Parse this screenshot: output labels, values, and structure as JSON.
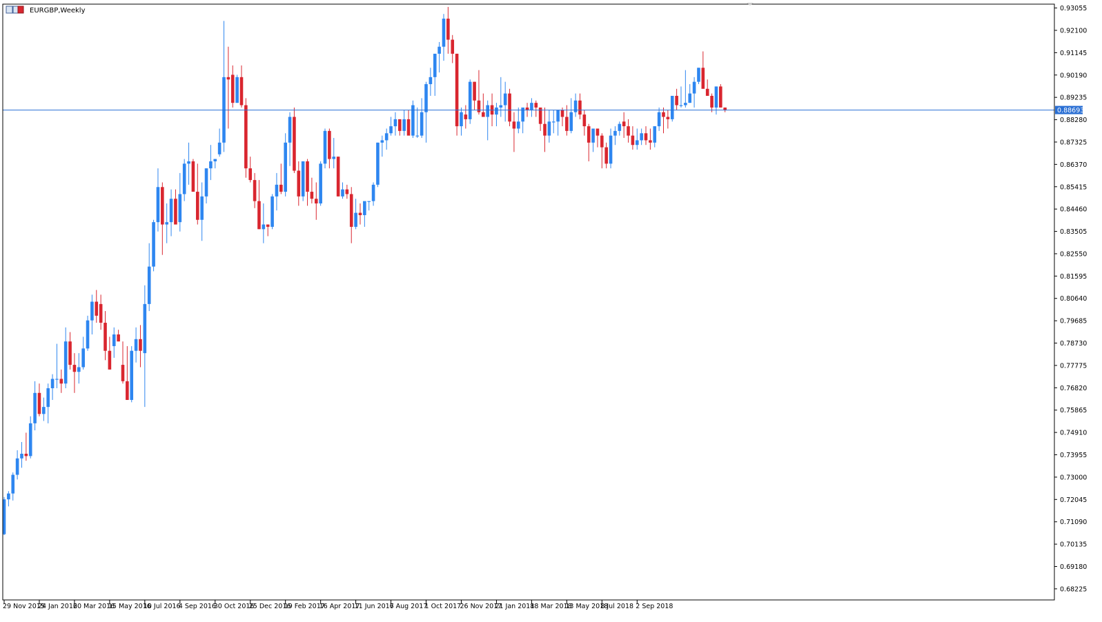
{
  "chart_title": "EURGBP,Weekly",
  "colors": {
    "bull": "#2e86f0",
    "bear": "#d9262f",
    "hline": "#2a6fd4",
    "axis": "#000000",
    "price_tag_bg": "#2a6fd4"
  },
  "icons": [
    "chart-window-icon"
  ],
  "chart_data": {
    "type": "candlestick",
    "title": "EURGBP,Weekly",
    "ylim": [
      0.6775,
      0.9322
    ],
    "y_ticks": [
      "0.93055",
      "0.92100",
      "0.91145",
      "0.90190",
      "0.89235",
      "0.88280",
      "0.87325",
      "0.86370",
      "0.85415",
      "0.84460",
      "0.83505",
      "0.82550",
      "0.81595",
      "0.80640",
      "0.79685",
      "0.78730",
      "0.77775",
      "0.76820",
      "0.75865",
      "0.74910",
      "0.73955",
      "0.73000",
      "0.72045",
      "0.71090",
      "0.70135",
      "0.69180",
      "0.68225"
    ],
    "x_ticks": [
      "29 Nov 2015",
      "24 Jan 2016",
      "20 Mar 2016",
      "15 May 2016",
      "10 Jul 2016",
      "4 Sep 2016",
      "30 Oct 2016",
      "25 Dec 2016",
      "19 Feb 2017",
      "16 Apr 2017",
      "11 Jun 2017",
      "6 Aug 2017",
      "1 Oct 2017",
      "26 Nov 2017",
      "21 Jan 2018",
      "18 Mar 2018",
      "13 May 2018",
      "8 Jul 2018",
      "2 Sep 2018"
    ],
    "horizontal_line": {
      "value": 0.88693,
      "label": "0.88693"
    },
    "ohlc": [
      [
        0.7056,
        0.7215,
        0.7052,
        0.7205
      ],
      [
        0.7205,
        0.724,
        0.7175,
        0.723
      ],
      [
        0.723,
        0.732,
        0.72,
        0.731
      ],
      [
        0.731,
        0.7415,
        0.729,
        0.738
      ],
      [
        0.738,
        0.745,
        0.734,
        0.74
      ],
      [
        0.74,
        0.749,
        0.737,
        0.739
      ],
      [
        0.739,
        0.756,
        0.738,
        0.753
      ],
      [
        0.753,
        0.771,
        0.75,
        0.766
      ],
      [
        0.766,
        0.77,
        0.756,
        0.757
      ],
      [
        0.757,
        0.764,
        0.754,
        0.76
      ],
      [
        0.76,
        0.77,
        0.753,
        0.768
      ],
      [
        0.768,
        0.774,
        0.763,
        0.772
      ],
      [
        0.772,
        0.787,
        0.768,
        0.772
      ],
      [
        0.772,
        0.776,
        0.766,
        0.77
      ],
      [
        0.77,
        0.794,
        0.768,
        0.788
      ],
      [
        0.788,
        0.792,
        0.776,
        0.778
      ],
      [
        0.778,
        0.783,
        0.766,
        0.775
      ],
      [
        0.775,
        0.783,
        0.77,
        0.777
      ],
      [
        0.777,
        0.79,
        0.776,
        0.785
      ],
      [
        0.785,
        0.799,
        0.784,
        0.797
      ],
      [
        0.797,
        0.808,
        0.791,
        0.805
      ],
      [
        0.805,
        0.81,
        0.796,
        0.799
      ],
      [
        0.804,
        0.808,
        0.793,
        0.796
      ],
      [
        0.796,
        0.801,
        0.78,
        0.784
      ],
      [
        0.784,
        0.79,
        0.776,
        0.776
      ],
      [
        0.786,
        0.794,
        0.781,
        0.791
      ],
      [
        0.791,
        0.793,
        0.788,
        0.788
      ],
      [
        0.778,
        0.788,
        0.77,
        0.771
      ],
      [
        0.771,
        0.786,
        0.763,
        0.763
      ],
      [
        0.763,
        0.786,
        0.762,
        0.784
      ],
      [
        0.784,
        0.794,
        0.779,
        0.789
      ],
      [
        0.789,
        0.795,
        0.777,
        0.784
      ],
      [
        0.783,
        0.812,
        0.76,
        0.804
      ],
      [
        0.804,
        0.83,
        0.801,
        0.82
      ],
      [
        0.82,
        0.84,
        0.818,
        0.839
      ],
      [
        0.839,
        0.862,
        0.835,
        0.854
      ],
      [
        0.854,
        0.856,
        0.825,
        0.838
      ],
      [
        0.838,
        0.847,
        0.83,
        0.839
      ],
      [
        0.839,
        0.853,
        0.833,
        0.849
      ],
      [
        0.849,
        0.853,
        0.839,
        0.838
      ],
      [
        0.839,
        0.86,
        0.835,
        0.851
      ],
      [
        0.851,
        0.866,
        0.848,
        0.864
      ],
      [
        0.864,
        0.873,
        0.855,
        0.865
      ],
      [
        0.865,
        0.866,
        0.853,
        0.852
      ],
      [
        0.852,
        0.864,
        0.838,
        0.84
      ],
      [
        0.84,
        0.856,
        0.831,
        0.85
      ],
      [
        0.85,
        0.862,
        0.847,
        0.862
      ],
      [
        0.862,
        0.872,
        0.857,
        0.865
      ],
      [
        0.865,
        0.866,
        0.862,
        0.866
      ],
      [
        0.868,
        0.879,
        0.867,
        0.873
      ],
      [
        0.873,
        0.925,
        0.869,
        0.901
      ],
      [
        0.901,
        0.914,
        0.879,
        0.9
      ],
      [
        0.902,
        0.906,
        0.888,
        0.89
      ],
      [
        0.89,
        0.902,
        0.89,
        0.901
      ],
      [
        0.901,
        0.906,
        0.888,
        0.889
      ],
      [
        0.889,
        0.892,
        0.858,
        0.862
      ],
      [
        0.862,
        0.867,
        0.856,
        0.857
      ],
      [
        0.857,
        0.86,
        0.845,
        0.848
      ],
      [
        0.848,
        0.857,
        0.836,
        0.836
      ],
      [
        0.836,
        0.847,
        0.83,
        0.838
      ],
      [
        0.838,
        0.838,
        0.833,
        0.837
      ],
      [
        0.837,
        0.851,
        0.836,
        0.85
      ],
      [
        0.85,
        0.86,
        0.844,
        0.855
      ],
      [
        0.855,
        0.864,
        0.851,
        0.852
      ],
      [
        0.852,
        0.877,
        0.85,
        0.873
      ],
      [
        0.873,
        0.886,
        0.863,
        0.884
      ],
      [
        0.884,
        0.888,
        0.86,
        0.861
      ],
      [
        0.861,
        0.865,
        0.846,
        0.85
      ],
      [
        0.85,
        0.865,
        0.848,
        0.865
      ],
      [
        0.865,
        0.866,
        0.846,
        0.852
      ],
      [
        0.852,
        0.858,
        0.847,
        0.849
      ],
      [
        0.849,
        0.856,
        0.84,
        0.847
      ],
      [
        0.847,
        0.865,
        0.846,
        0.864
      ],
      [
        0.864,
        0.879,
        0.862,
        0.878
      ],
      [
        0.878,
        0.879,
        0.862,
        0.866
      ],
      [
        0.866,
        0.875,
        0.862,
        0.867
      ],
      [
        0.867,
        0.867,
        0.85,
        0.85
      ],
      [
        0.85,
        0.856,
        0.849,
        0.853
      ],
      [
        0.853,
        0.855,
        0.849,
        0.851
      ],
      [
        0.851,
        0.854,
        0.83,
        0.837
      ],
      [
        0.837,
        0.849,
        0.836,
        0.843
      ],
      [
        0.843,
        0.847,
        0.838,
        0.842
      ],
      [
        0.842,
        0.846,
        0.837,
        0.848
      ],
      [
        0.848,
        0.848,
        0.844,
        0.848
      ],
      [
        0.848,
        0.856,
        0.846,
        0.855
      ],
      [
        0.855,
        0.873,
        0.854,
        0.873
      ],
      [
        0.873,
        0.876,
        0.867,
        0.874
      ],
      [
        0.874,
        0.879,
        0.87,
        0.877
      ],
      [
        0.877,
        0.884,
        0.876,
        0.88
      ],
      [
        0.88,
        0.886,
        0.876,
        0.883
      ],
      [
        0.883,
        0.883,
        0.876,
        0.878
      ],
      [
        0.878,
        0.887,
        0.876,
        0.883
      ],
      [
        0.883,
        0.887,
        0.877,
        0.876
      ],
      [
        0.876,
        0.891,
        0.875,
        0.889
      ],
      [
        0.876,
        0.888,
        0.875,
        0.876
      ],
      [
        0.876,
        0.892,
        0.875,
        0.886
      ],
      [
        0.886,
        0.899,
        0.873,
        0.898
      ],
      [
        0.898,
        0.905,
        0.893,
        0.901
      ],
      [
        0.901,
        0.91,
        0.893,
        0.911
      ],
      [
        0.911,
        0.916,
        0.903,
        0.914
      ],
      [
        0.914,
        0.928,
        0.908,
        0.926
      ],
      [
        0.926,
        0.931,
        0.911,
        0.917
      ],
      [
        0.917,
        0.919,
        0.907,
        0.911
      ],
      [
        0.911,
        0.911,
        0.876,
        0.88
      ],
      [
        0.88,
        0.888,
        0.876,
        0.886
      ],
      [
        0.885,
        0.889,
        0.879,
        0.883
      ],
      [
        0.883,
        0.9,
        0.881,
        0.899
      ],
      [
        0.899,
        0.899,
        0.887,
        0.891
      ],
      [
        0.891,
        0.904,
        0.885,
        0.886
      ],
      [
        0.886,
        0.894,
        0.884,
        0.884
      ],
      [
        0.884,
        0.891,
        0.874,
        0.889
      ],
      [
        0.889,
        0.894,
        0.88,
        0.885
      ],
      [
        0.885,
        0.89,
        0.88,
        0.888
      ],
      [
        0.888,
        0.901,
        0.884,
        0.889
      ],
      [
        0.889,
        0.899,
        0.882,
        0.894
      ],
      [
        0.894,
        0.896,
        0.88,
        0.882
      ],
      [
        0.882,
        0.886,
        0.869,
        0.879
      ],
      [
        0.879,
        0.888,
        0.877,
        0.882
      ],
      [
        0.882,
        0.886,
        0.877,
        0.888
      ],
      [
        0.888,
        0.89,
        0.884,
        0.887
      ],
      [
        0.887,
        0.892,
        0.884,
        0.89
      ],
      [
        0.89,
        0.891,
        0.884,
        0.888
      ],
      [
        0.888,
        0.888,
        0.878,
        0.881
      ],
      [
        0.881,
        0.888,
        0.869,
        0.876
      ],
      [
        0.876,
        0.887,
        0.873,
        0.882
      ],
      [
        0.882,
        0.887,
        0.877,
        0.882
      ],
      [
        0.882,
        0.886,
        0.876,
        0.887
      ],
      [
        0.887,
        0.888,
        0.88,
        0.884
      ],
      [
        0.884,
        0.889,
        0.876,
        0.878
      ],
      [
        0.878,
        0.892,
        0.877,
        0.886
      ],
      [
        0.886,
        0.894,
        0.884,
        0.891
      ],
      [
        0.891,
        0.894,
        0.883,
        0.885
      ],
      [
        0.885,
        0.887,
        0.876,
        0.88
      ],
      [
        0.88,
        0.881,
        0.865,
        0.873
      ],
      [
        0.873,
        0.879,
        0.869,
        0.879
      ],
      [
        0.879,
        0.879,
        0.871,
        0.876
      ],
      [
        0.876,
        0.877,
        0.862,
        0.871
      ],
      [
        0.871,
        0.873,
        0.862,
        0.864
      ],
      [
        0.864,
        0.879,
        0.862,
        0.876
      ],
      [
        0.876,
        0.88,
        0.872,
        0.878
      ],
      [
        0.878,
        0.882,
        0.876,
        0.881
      ],
      [
        0.882,
        0.886,
        0.875,
        0.88
      ],
      [
        0.88,
        0.883,
        0.873,
        0.876
      ],
      [
        0.876,
        0.88,
        0.87,
        0.872
      ],
      [
        0.872,
        0.879,
        0.87,
        0.874
      ],
      [
        0.874,
        0.879,
        0.872,
        0.877
      ],
      [
        0.877,
        0.88,
        0.872,
        0.874
      ],
      [
        0.874,
        0.879,
        0.87,
        0.873
      ],
      [
        0.873,
        0.88,
        0.871,
        0.88
      ],
      [
        0.88,
        0.888,
        0.878,
        0.886
      ],
      [
        0.886,
        0.888,
        0.877,
        0.884
      ],
      [
        0.884,
        0.887,
        0.879,
        0.883
      ],
      [
        0.883,
        0.893,
        0.882,
        0.893
      ],
      [
        0.893,
        0.896,
        0.887,
        0.889
      ],
      [
        0.889,
        0.897,
        0.888,
        0.889
      ],
      [
        0.889,
        0.904,
        0.888,
        0.89
      ],
      [
        0.89,
        0.898,
        0.89,
        0.894
      ],
      [
        0.894,
        0.901,
        0.888,
        0.899
      ],
      [
        0.899,
        0.905,
        0.898,
        0.905
      ],
      [
        0.905,
        0.912,
        0.899,
        0.896
      ],
      [
        0.896,
        0.9,
        0.893,
        0.893
      ],
      [
        0.893,
        0.894,
        0.886,
        0.888
      ],
      [
        0.888,
        0.897,
        0.885,
        0.897
      ],
      [
        0.897,
        0.898,
        0.888,
        0.888
      ],
      [
        0.888,
        0.888,
        0.886,
        0.8869
      ]
    ]
  }
}
